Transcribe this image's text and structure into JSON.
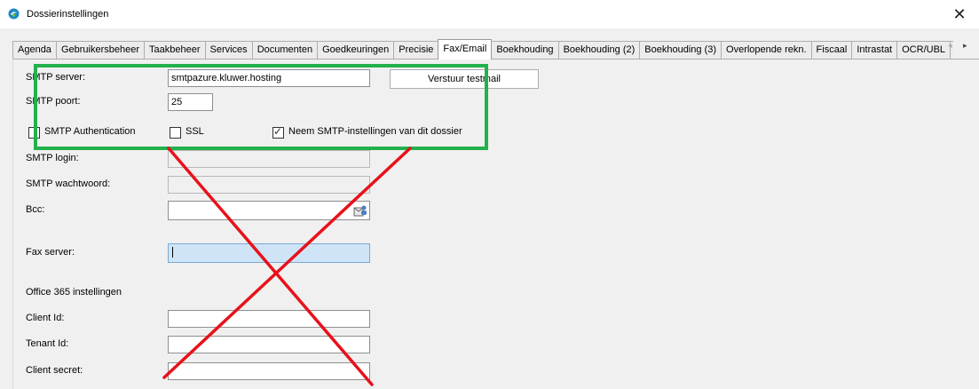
{
  "window": {
    "title": "Dossierinstellingen",
    "app_icon": "blue-swirl-app-icon",
    "close_glyph": "✕"
  },
  "tabs": [
    {
      "label": "Agenda",
      "active": false
    },
    {
      "label": "Gebruikersbeheer",
      "active": false
    },
    {
      "label": "Taakbeheer",
      "active": false
    },
    {
      "label": "Services",
      "active": false
    },
    {
      "label": "Documenten",
      "active": false
    },
    {
      "label": "Goedkeuringen",
      "active": false
    },
    {
      "label": "Precisie",
      "active": false
    },
    {
      "label": "Fax/Email",
      "active": true
    },
    {
      "label": "Boekhouding",
      "active": false
    },
    {
      "label": "Boekhouding (2)",
      "active": false
    },
    {
      "label": "Boekhouding (3)",
      "active": false
    },
    {
      "label": "Overlopende rekn.",
      "active": false
    },
    {
      "label": "Fiscaal",
      "active": false
    },
    {
      "label": "Intrastat",
      "active": false
    },
    {
      "label": "OCR/UBL",
      "active": false
    },
    {
      "label": "E",
      "active": false
    }
  ],
  "tab_scroll": {
    "left": "◂",
    "right": "▸"
  },
  "form": {
    "smtp_server": {
      "label": "SMTP server:",
      "value": "smtpazure.kluwer.hosting"
    },
    "test_button": "Verstuur testmail",
    "smtp_port": {
      "label": "SMTP poort:",
      "value": "25"
    },
    "smtp_auth": {
      "label": "SMTP Authentication",
      "checked": false
    },
    "ssl": {
      "label": "SSL",
      "checked": false
    },
    "use_dossier_smtp": {
      "label": "Neem SMTP-instellingen van dit dossier",
      "checked": true
    },
    "smtp_login": {
      "label": "SMTP login:",
      "value": ""
    },
    "smtp_password": {
      "label": "SMTP wachtwoord:",
      "value": ""
    },
    "bcc": {
      "label": "Bcc:",
      "value": ""
    },
    "fax_server": {
      "label": "Fax server:",
      "value": ""
    },
    "o365_section": "Office 365 instellingen",
    "client_id": {
      "label": "Client Id:",
      "value": ""
    },
    "tenant_id": {
      "label": "Tenant Id:",
      "value": ""
    },
    "client_secret": {
      "label": "Client secret:",
      "value": ""
    }
  },
  "checkbox_tick": "✓",
  "annotation": {
    "highlight_box_color": "#22b14c",
    "cross_color": "#e8111a"
  }
}
